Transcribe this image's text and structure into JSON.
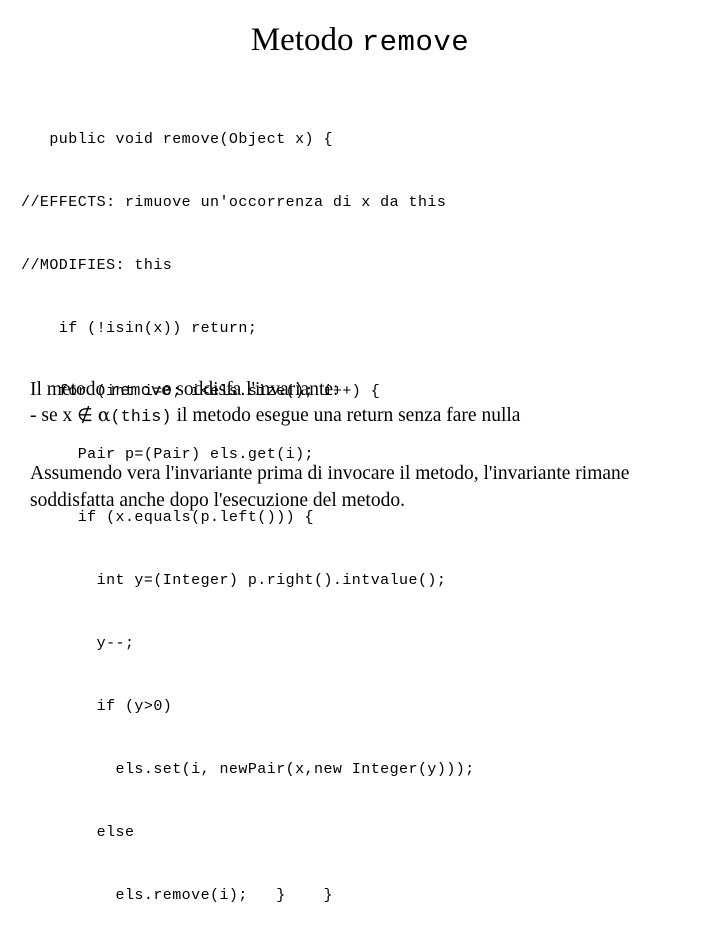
{
  "slide": {
    "title": {
      "serif_part": "Metodo",
      "mono_part": "remove"
    },
    "code_lines": [
      "   public void remove(Object x) {",
      "//EFFECTS: rimuove un'occorrenza di x da this",
      "//MODIFIES: this",
      "    if (!isin(x)) return;",
      "    for (int i=0; i<els.size(); i++) {",
      "      Pair p=(Pair) els.get(i);",
      "      if (x.equals(p.left())) {",
      "        int y=(Integer) p.right().intvalue();",
      "        y--;",
      "        if (y>0)",
      "          els.set(i, newPair(x,new Integer(y)));",
      "        else",
      "          els.remove(i);   }    }"
    ],
    "invariant_paragraph": {
      "line1_pre": "Il metodo ",
      "line1_mono": "remove",
      "line1_post": " soddisfa l'invariante:",
      "line2_pre": "- se x ",
      "line2_symbol": "∉",
      "line2_alpha": "α",
      "line2_mono": "(this)",
      "line2_post": " il metodo esegue una return senza fare nulla"
    },
    "assumption_paragraph": {
      "text": "Assumendo vera l'invariante prima di invocare il metodo, l'invariante rimane soddisfatta anche dopo l'esecuzione del metodo."
    },
    "colors": {
      "background": "#ffffff",
      "text": "#000000"
    }
  }
}
